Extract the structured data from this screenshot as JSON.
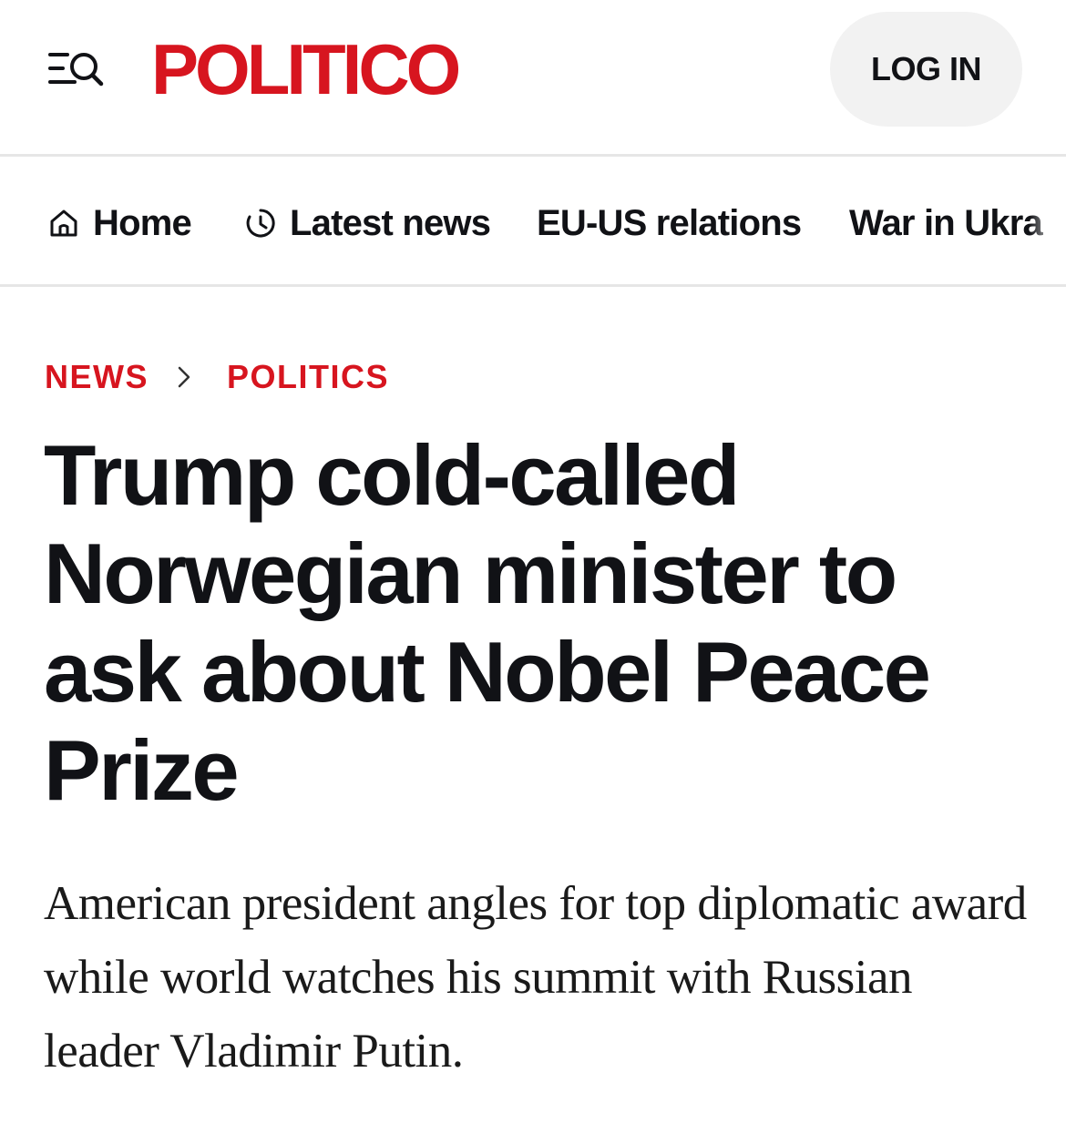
{
  "header": {
    "logo": "POLITICO",
    "login_label": "LOG IN",
    "menu_icon": "menu-search-icon"
  },
  "nav": {
    "items": [
      {
        "label": "Home",
        "icon": "home-icon"
      },
      {
        "label": "Latest news",
        "icon": "clock-icon"
      },
      {
        "label": "EU-US relations"
      },
      {
        "label": "War in Ukra"
      }
    ]
  },
  "breadcrumb": {
    "items": [
      "NEWS",
      "POLITICS"
    ],
    "separator_icon": "chevron-right-icon"
  },
  "article": {
    "headline": "Trump cold-called Norwegian minister to ask about Nobel Peace Prize",
    "dek": "American president angles for top diplomatic award while world watches his summit with Russian leader Vladimir Putin."
  },
  "colors": {
    "brand_red": "#d7151f",
    "text": "#111216",
    "button_bg": "#f2f2f2",
    "divider": "#e6e6e6"
  }
}
